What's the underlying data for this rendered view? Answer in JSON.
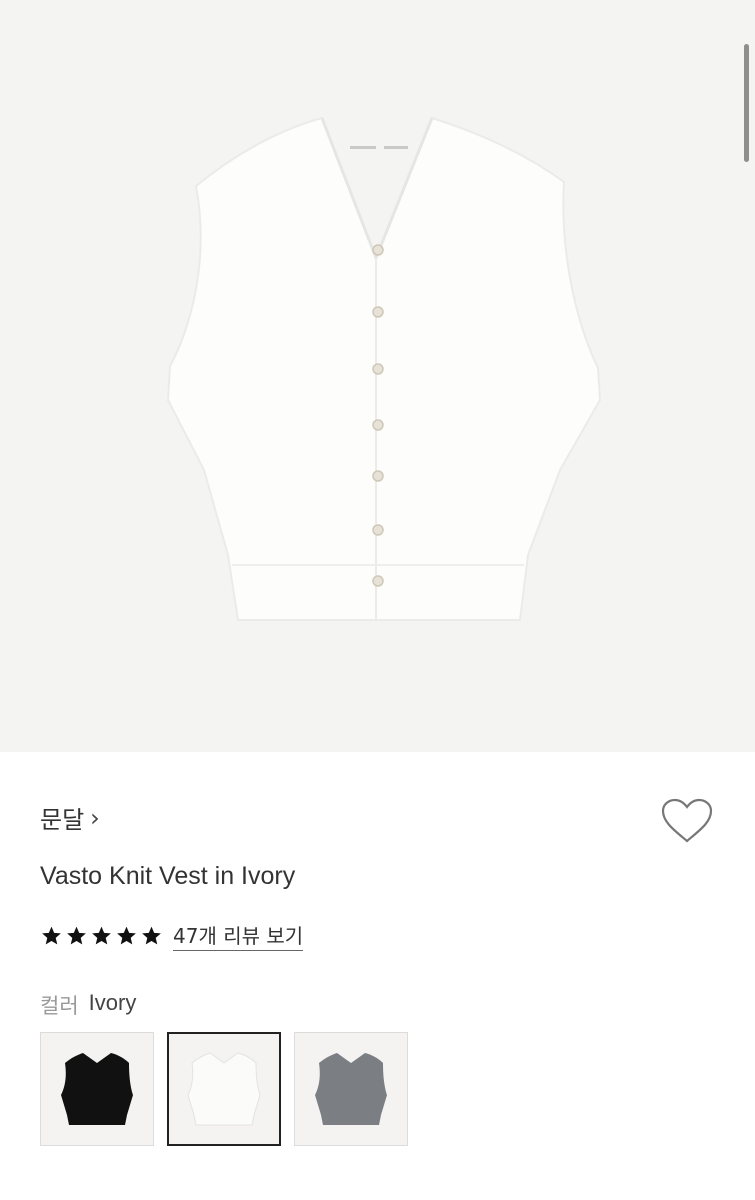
{
  "product": {
    "brand": "문달",
    "brand_chevron": "›",
    "title": "Vasto Knit Vest in Ivory",
    "rating_stars": 5,
    "review_link": "47개 리뷰 보기",
    "color_label": "컬러",
    "color_value": "Ivory"
  },
  "swatches": [
    {
      "name": "black",
      "color": "#111111"
    },
    {
      "name": "ivory",
      "color": "#f1f1ef",
      "selected": true
    },
    {
      "name": "grey",
      "color": "#7b7f84"
    }
  ],
  "colors": {
    "hero_bg": "#f4f4f3",
    "text": "#333333",
    "muted": "#999999"
  },
  "icons": {
    "wishlist": "heart-outline-icon",
    "star": "star-filled-icon",
    "brand_link": "chevron-right-icon"
  }
}
